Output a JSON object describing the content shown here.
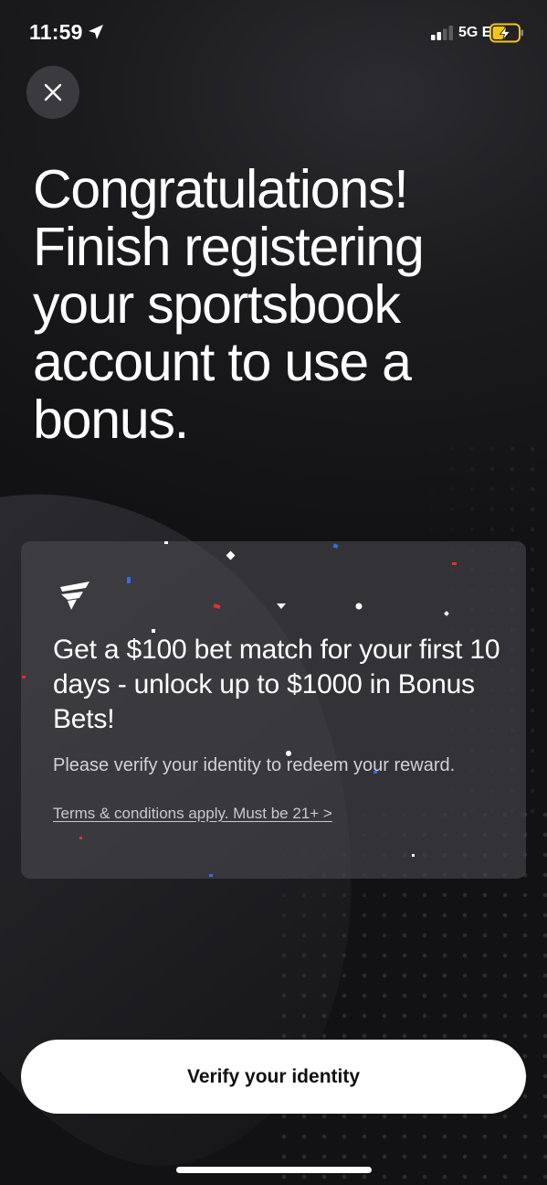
{
  "status_bar": {
    "time": "11:59",
    "network": "5G E"
  },
  "close_button": {
    "icon": "close-icon"
  },
  "title": "Congratulations! Finish registering your sportsbook account to use a bonus.",
  "promo": {
    "logo": "fanatics-logo",
    "headline": "Get a $100 bet match for your first 10 days - unlock up to $1000 in Bonus Bets!",
    "subtext": "Please verify your identity to redeem your reward.",
    "terms_link": "Terms & conditions apply. Must be 21+ >"
  },
  "cta": {
    "label": "Verify your identity"
  },
  "colors": {
    "background": "#141416",
    "card": "#48484e",
    "button": "#ffffff",
    "button_text": "#111111",
    "battery_charging": "#f5c518",
    "confetti_red": "#e0322f",
    "confetti_blue": "#2f6fe0"
  }
}
